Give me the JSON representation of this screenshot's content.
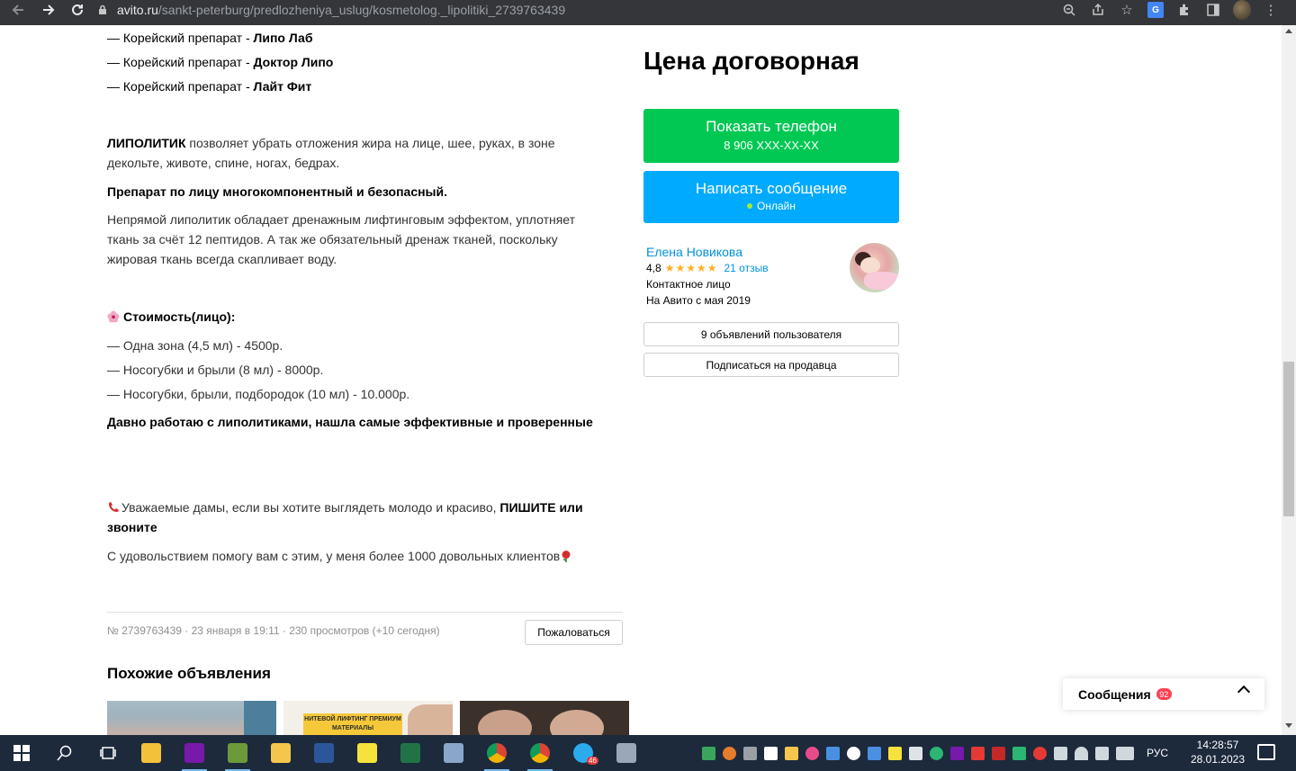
{
  "browser": {
    "url_domain": "avito.ru",
    "url_path": "/sankt-peterburg/predlozheniya_uslug/kosmetolog._lipolitiki_2739763439",
    "icons": [
      "back-icon",
      "forward-icon",
      "reload-icon",
      "lock-icon",
      "zoom-icon",
      "share-icon",
      "bookmark-star-icon",
      "translate-icon",
      "extensions-icon",
      "sidebar-icon",
      "profile-avatar",
      "menu-dots-icon"
    ],
    "translate_label": "G"
  },
  "description": {
    "items_top": [
      {
        "prefix": "— Корейский препарат - ",
        "bold": "Липо Лаб"
      },
      {
        "prefix": "— Корейский препарат - ",
        "bold": "Доктор Липо"
      },
      {
        "prefix": "— Корейский препарат - ",
        "bold": "Лайт Фит"
      }
    ],
    "para1_bold": "ЛИПОЛИТИК",
    "para1_line1": " позволяет убрать отложения жира на лице, шее, руках, в зоне",
    "para1_line2": "декольте, животе, спине, ногах, бедрах.",
    "para2": "Препарат по лицу многокомпонентный и безопасный.",
    "para3_line1": "Непрямой липолитик обладает дренажным лифтинговым эффектом, уплотняет",
    "para3_line2": "ткань за счёт 12 пептидов. А так же обязательный дренаж тканей, поскольку",
    "para3_line3": "жировая ткань всегда скапливает воду.",
    "cost_title": "Стоимость(лицо):",
    "cost_items": [
      "— Одна зона (4,5 мл) - 4500р.",
      "— Носогубки и брыли (8 мл) - 8000р.",
      "— Носогубки, брыли, подбородок (10 мл) - 10.000р."
    ],
    "para4": "Давно работаю с липолитиками, нашла самые эффективные и проверенные",
    "para5_text": "Уважаемые дамы, если вы хотите выглядеть молодо и красиво, ",
    "para5_bold1": "ПИШИТЕ или",
    "para5_bold2": "звоните",
    "para6": "С удовольствием помогу вам с этим, у меня более 1000 довольных клиентов"
  },
  "sidebar": {
    "price": "Цена договорная",
    "phone_button_label": "Показать телефон",
    "phone_number": "8 906 XXX-XX-XX",
    "message_button_label": "Написать сообщение",
    "online_status": "Онлайн",
    "seller_name": "Елена Новикова",
    "rating": "4,8",
    "stars": "★★★★★",
    "reviews": "21 отзыв",
    "seller_role": "Контактное лицо",
    "seller_since": "На Авито с мая 2019",
    "ads_button": "9 объявлений пользователя",
    "subscribe_button": "Подписаться на продавца"
  },
  "footer": {
    "meta": "№ 2739763439 · 23 января в 19:11 · 230 просмотров (+10 сегодня)",
    "report_button": "Пожаловаться",
    "similar_title": "Похожие объявления",
    "thumb2_banner": "НИТЕВОЙ ЛИФТИНГ ПРЕМИУМ МАТЕРИАЛЫ"
  },
  "messages": {
    "label": "Сообщения",
    "badge": "92"
  },
  "taskbar": {
    "lang": "РУС",
    "time": "14:28:57",
    "date": "28.01.2023",
    "telegram_badge": "46",
    "colors": {
      "accent_green": "#00c853",
      "accent_blue": "#00aaff",
      "link": "#0091d9"
    }
  }
}
